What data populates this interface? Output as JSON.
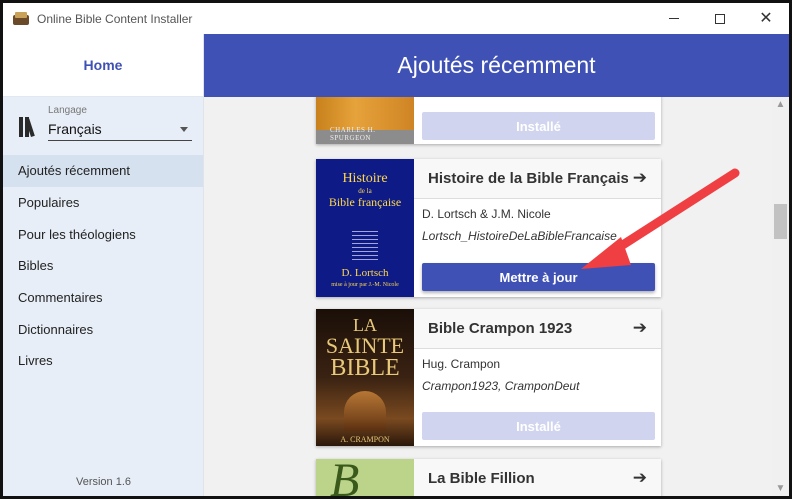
{
  "window": {
    "title": "Online Bible Content Installer",
    "controls": {
      "minimize": "minimize-icon",
      "maximize": "maximize-icon",
      "close": "close-icon"
    }
  },
  "sidebar": {
    "home_label": "Home",
    "language": {
      "caption": "Langage",
      "value": "Français"
    },
    "items": [
      {
        "label": "Ajoutés récemment",
        "active": true
      },
      {
        "label": "Populaires"
      },
      {
        "label": "Pour les théologiens"
      },
      {
        "label": "Bibles"
      },
      {
        "label": "Commentaires"
      },
      {
        "label": "Dictionnaires"
      },
      {
        "label": "Livres"
      }
    ],
    "version": "Version 1.6"
  },
  "header": {
    "title": "Ajoutés récemment"
  },
  "cards": [
    {
      "cover_text": "CHARLES H. SPURGEON",
      "button_label": "Installé",
      "button_state": "disabled"
    },
    {
      "title": "Histoire de la Bible Française",
      "author": "D. Lortsch & J.M. Nicole",
      "id": "Lortsch_HistoireDeLaBibleFrancaise",
      "cover": {
        "line1": "Histoire",
        "line2": "de la",
        "line3": "Bible française",
        "author": "D. Lortsch",
        "subtitle": "mise à jour par J.-M. Nicole"
      },
      "button_label": "Mettre à jour",
      "button_state": "primary"
    },
    {
      "title": "Bible Crampon 1923",
      "author": "Hug. Crampon",
      "id": "Crampon1923, CramponDeut",
      "cover": {
        "line1": "LA",
        "line2": "SAINTE",
        "line3": "BIBLE",
        "author": "A. CRAMPON"
      },
      "button_label": "Installé",
      "button_state": "disabled"
    },
    {
      "title": "La Bible Fillion",
      "cover": {
        "letter": "B"
      }
    }
  ],
  "colors": {
    "accent": "#3f51b5",
    "sidebar_bg": "#e7eef7",
    "button_disabled": "#d0d4ee",
    "annotation_arrow": "#ef3f42"
  }
}
